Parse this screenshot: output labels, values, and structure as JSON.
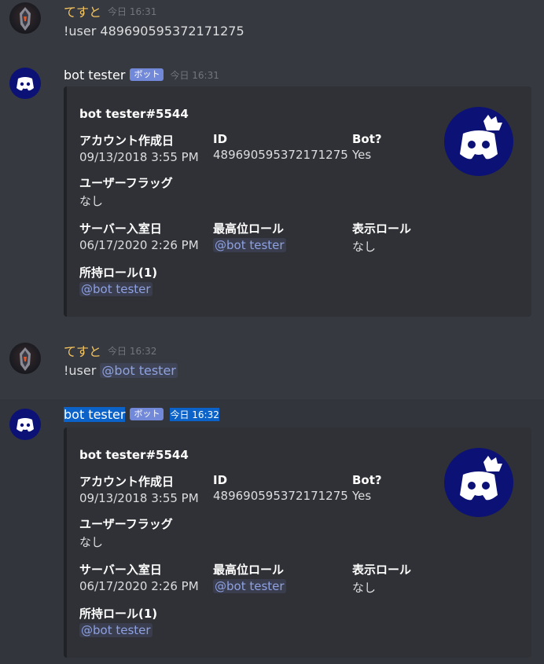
{
  "messages": [
    {
      "author": "てすと",
      "timestamp": "今日 16:31",
      "content": "!user 489690595372171275"
    },
    {
      "author": "bot tester",
      "badge": "ボット",
      "timestamp": "今日 16:31",
      "embed": {
        "title": "bot tester#5544",
        "fields": {
          "created_name": "アカウント作成日",
          "created_value": "09/13/2018 3:55 PM",
          "id_name": "ID",
          "id_value": "489690595372171275",
          "bot_name": "Bot?",
          "bot_value": "Yes",
          "flags_name": "ユーザーフラッグ",
          "flags_value": "なし",
          "joined_name": "サーバー入室日",
          "joined_value": "06/17/2020 2:26 PM",
          "top_role_name": "最高位ロール",
          "top_role_value": "@bot tester",
          "display_role_name": "表示ロール",
          "display_role_value": "なし",
          "roles_name": "所持ロール(1)",
          "roles_value": "@bot tester"
        }
      }
    },
    {
      "author": "てすと",
      "timestamp": "今日 16:32",
      "command": "!user",
      "mention": "@bot tester"
    },
    {
      "author": "bot tester",
      "badge": "ボット",
      "timestamp": "今日 16:32",
      "embed": {
        "title": "bot tester#5544",
        "fields": {
          "created_name": "アカウント作成日",
          "created_value": "09/13/2018 3:55 PM",
          "id_name": "ID",
          "id_value": "489690595372171275",
          "bot_name": "Bot?",
          "bot_value": "Yes",
          "flags_name": "ユーザーフラッグ",
          "flags_value": "なし",
          "joined_name": "サーバー入室日",
          "joined_value": "06/17/2020 2:26 PM",
          "top_role_name": "最高位ロール",
          "top_role_value": "@bot tester",
          "display_role_name": "表示ロール",
          "display_role_value": "なし",
          "roles_name": "所持ロール(1)",
          "roles_value": "@bot tester"
        }
      }
    }
  ],
  "colors": {
    "background": "#36393f",
    "embed_bg": "#2f3136",
    "user_name": "#f5c45d",
    "badge": "#7289da",
    "mention": "#8ea1e1",
    "selection": "#0b62c9"
  }
}
